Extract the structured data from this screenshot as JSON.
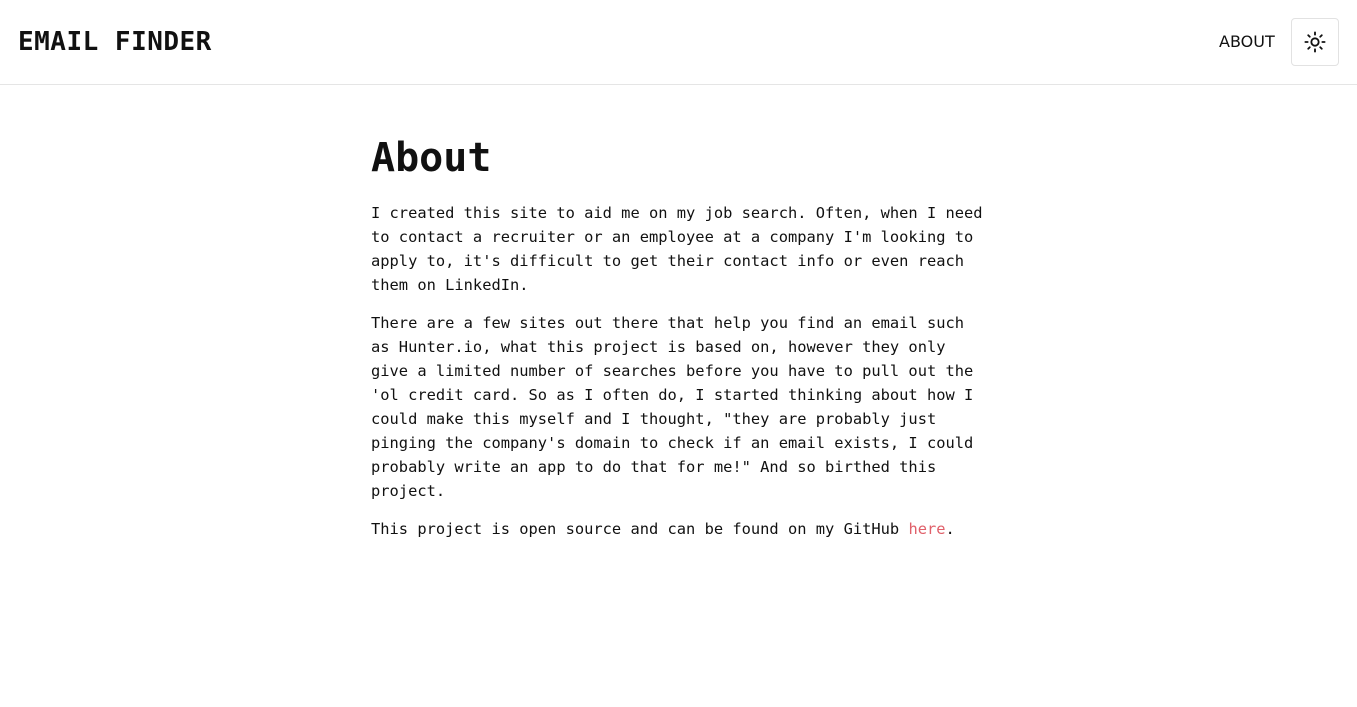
{
  "header": {
    "brand": "EMAIL FINDER",
    "nav_about": "ABOUT",
    "theme_toggle_icon": "sun-icon"
  },
  "main": {
    "title": "About",
    "paragraph1": "I created this site to aid me on my job search. Often, when I need\nto contact a recruiter or an employee at a company I'm looking to\napply to, it's difficult to get their contact info or even reach\nthem on LinkedIn.",
    "paragraph2": "There are a few sites out there that help you find an email such\nas Hunter.io, what this project is based on, however they only\ngive a limited number of searches before you have to pull out the\n'ol credit card. So as I often do, I started thinking about how I\ncould make this myself and I thought, \"they are probably just\npinging the company's domain to check if an email exists, I could\nprobably write an app to do that for me!\" And so birthed this\nproject.",
    "paragraph3_prefix": "This project is open source and can be found on my GitHub ",
    "paragraph3_link": "here",
    "paragraph3_suffix": "."
  },
  "colors": {
    "link": "#e0606a",
    "text": "#111111",
    "background": "#ffffff"
  }
}
